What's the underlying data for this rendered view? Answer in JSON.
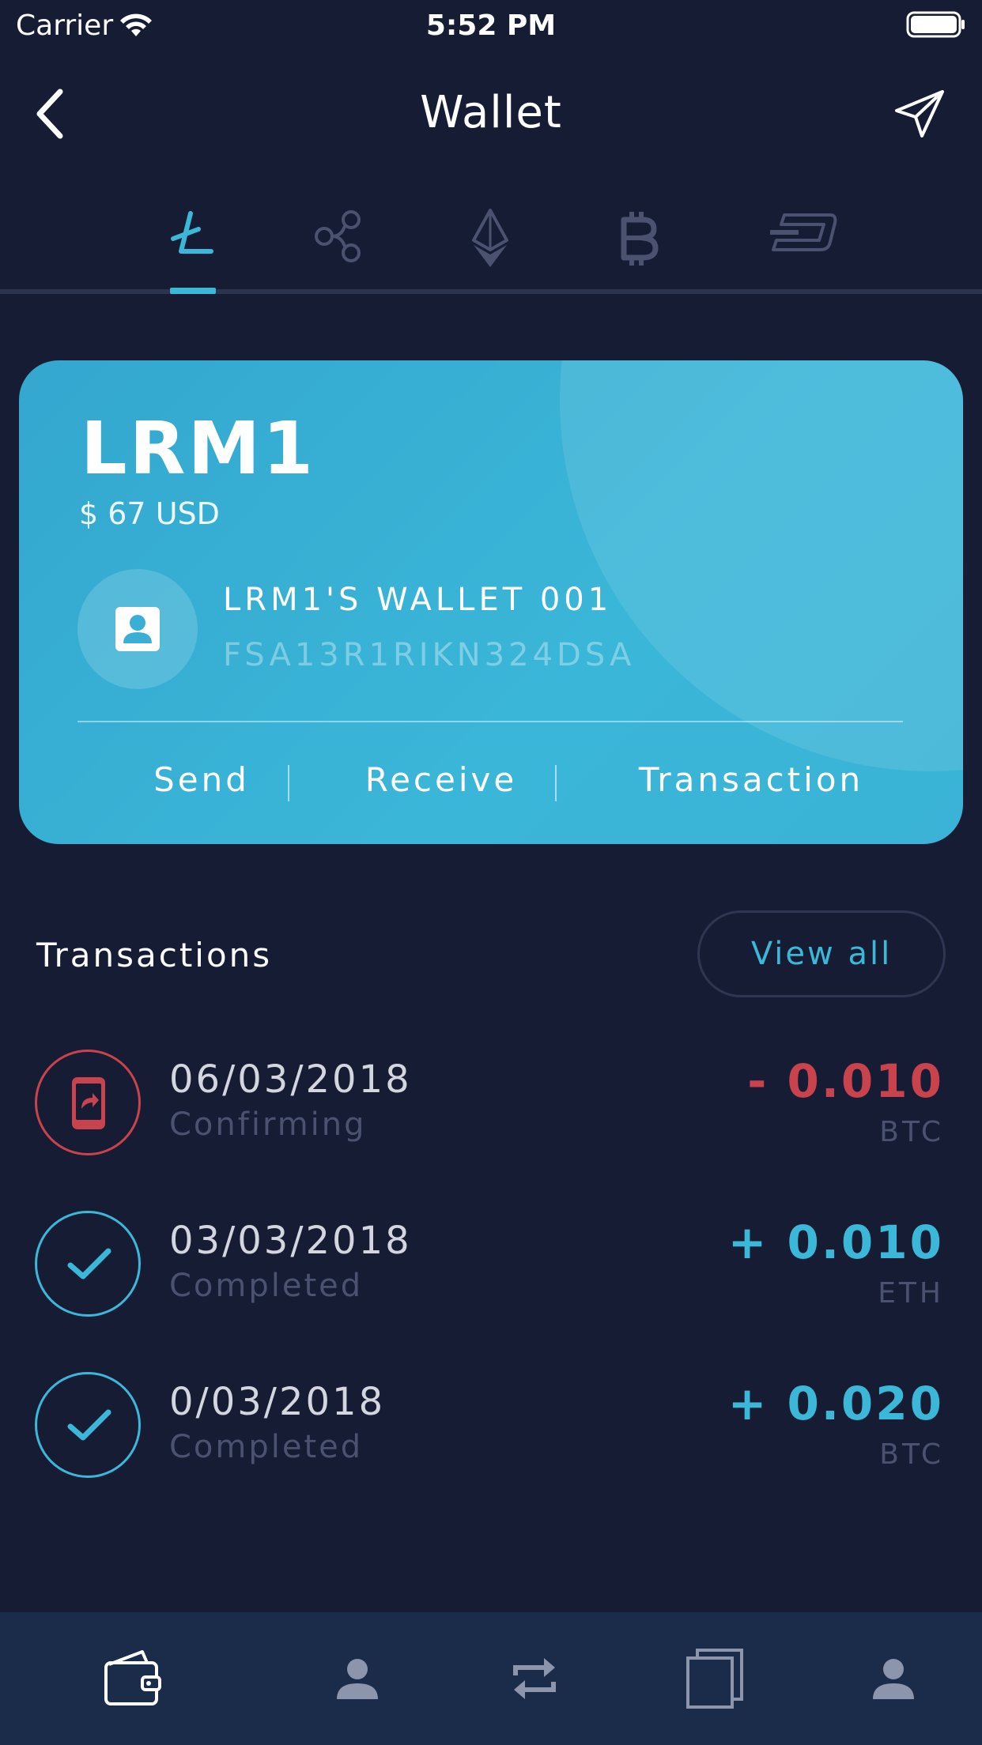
{
  "status_bar": {
    "carrier": "Carrier",
    "time": "5:52 PM"
  },
  "nav": {
    "title": "Wallet",
    "back_icon": "chevron-left-icon",
    "action_icon": "paper-plane-icon"
  },
  "coin_tabs": [
    {
      "name": "litecoin",
      "icon": "litecoin-icon",
      "active": true
    },
    {
      "name": "ripple",
      "icon": "ripple-icon",
      "active": false
    },
    {
      "name": "ethereum",
      "icon": "ethereum-icon",
      "active": false
    },
    {
      "name": "bitcoin",
      "icon": "bitcoin-icon",
      "active": false
    },
    {
      "name": "dash",
      "icon": "dash-icon",
      "active": false
    }
  ],
  "wallet_card": {
    "name": "LRM1",
    "balance_usd": "$ 67 USD",
    "wallet_name": "LRM1'S WALLET 001",
    "wallet_id": "FSA13R1RIKN324DSA",
    "actions": {
      "send": "Send",
      "receive": "Receive",
      "transaction": "Transaction"
    }
  },
  "transactions": {
    "title": "Transactions",
    "view_all": "View all",
    "items": [
      {
        "date": "06/03/2018",
        "status": "Confirming",
        "amount": "- 0.010",
        "coin": "BTC",
        "direction": "out"
      },
      {
        "date": "03/03/2018",
        "status": "Completed",
        "amount": "+ 0.010",
        "coin": "ETH",
        "direction": "in"
      },
      {
        "date": "0/03/2018",
        "status": "Completed",
        "amount": "+ 0.020",
        "coin": "BTC",
        "direction": "in"
      }
    ]
  },
  "bottom_nav": [
    {
      "name": "wallet",
      "icon": "wallet-icon",
      "active": true
    },
    {
      "name": "contacts",
      "icon": "person-icon",
      "active": false
    },
    {
      "name": "exchange",
      "icon": "exchange-arrows-icon",
      "active": false
    },
    {
      "name": "cards",
      "icon": "stacked-cards-icon",
      "active": false
    },
    {
      "name": "profile",
      "icon": "profile-icon",
      "active": false
    }
  ],
  "colors": {
    "background": "#161c34",
    "accent": "#3bb8d8",
    "negative": "#c8434d",
    "bottom_bar": "#1b2b4a"
  }
}
